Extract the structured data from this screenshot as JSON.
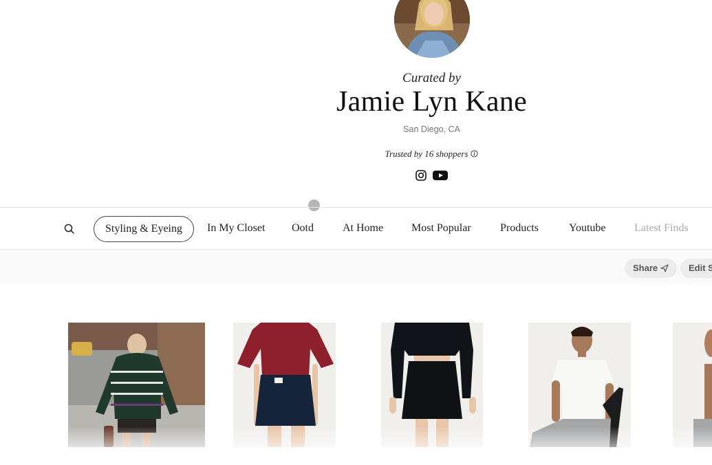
{
  "profile": {
    "curated_label": "Curated by",
    "name": "Jamie Lyn Kane",
    "location": "San Diego, CA",
    "trusted_text": "Trusted by 16 shoppers",
    "socials": [
      "instagram-icon",
      "youtube-icon"
    ]
  },
  "tabs": [
    {
      "label": "Styling & Eyeing",
      "active": true
    },
    {
      "label": "In My Closet"
    },
    {
      "label": "Ootd"
    },
    {
      "label": "At Home"
    },
    {
      "label": "Most Popular"
    },
    {
      "label": "Products"
    },
    {
      "label": "Youtube"
    },
    {
      "label": "Latest Finds"
    }
  ],
  "actions": {
    "share_label": "Share",
    "edit_label": "Edit S"
  },
  "products": [
    {
      "name": "striped-sweater-image"
    },
    {
      "name": "red-knit-denim-skirt-image"
    },
    {
      "name": "black-cardigan-mini-skirt-image"
    },
    {
      "name": "white-tee-image"
    },
    {
      "name": "partial-product-image"
    }
  ],
  "colors": {
    "accent": "#111111",
    "muted": "#777777",
    "pill_bg": "#ececec"
  }
}
